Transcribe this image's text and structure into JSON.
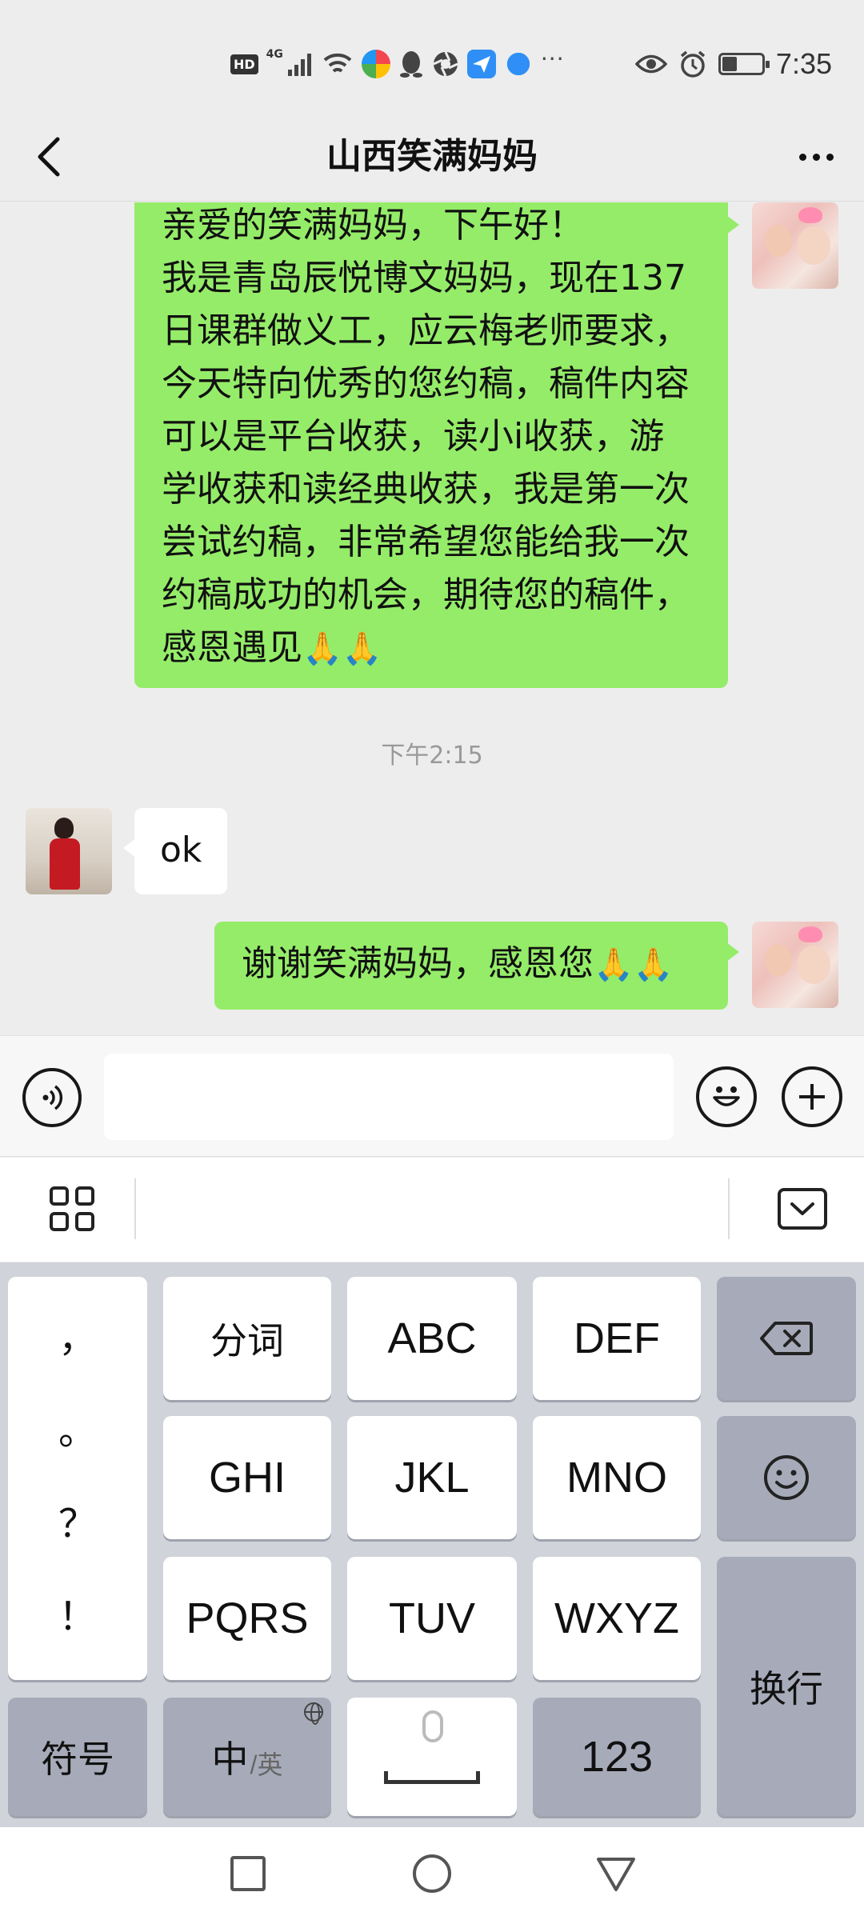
{
  "status_bar": {
    "network_badge": "HD",
    "network_type": "4G",
    "more_indicator": "···",
    "time": "7:35",
    "battery_level": 0.35,
    "app_colors": [
      "#f4464f",
      "#4aa9e8",
      "#20a8ec",
      "#2f8ff6"
    ]
  },
  "nav": {
    "back_icon": "chevron-left-icon",
    "title": "山西笑满妈妈",
    "more_icon": "more-horizontal-icon"
  },
  "chat": {
    "messages": [
      {
        "sender": "me",
        "text": "亲爱的笑满妈妈，下午好！\n我是青岛辰悦博文妈妈，现在137\n日课群做义工，应云梅老师要求，\n今天特向优秀的您约稿，稿件内容\n可以是平台收获，读小i收获，游\n学收获和读经典收获，我是第一次\n尝试约稿，非常希望您能给我一次\n约稿成功的机会，期待您的稿件，\n感恩遇见",
        "emoji": "🙏🙏"
      },
      {
        "type": "timestamp",
        "text": "下午2:15"
      },
      {
        "sender": "other",
        "text": "ok"
      },
      {
        "sender": "me",
        "text": "谢谢笑满妈妈，感恩您",
        "emoji": "🙏🙏"
      }
    ]
  },
  "input_bar": {
    "voice_icon": "voice-icon",
    "input_value": "",
    "emoji_icon": "smiley-icon",
    "plus_icon": "plus-icon"
  },
  "ime": {
    "menu_icon": "grid-icon",
    "collapse_icon": "keyboard-collapse-icon",
    "punctuation": [
      "，",
      "。",
      "？",
      "！"
    ],
    "keys_row1": [
      "分词",
      "ABC",
      "DEF"
    ],
    "keys_row2": [
      "GHI",
      "JKL",
      "MNO"
    ],
    "keys_row3": [
      "PQRS",
      "TUV",
      "WXYZ"
    ],
    "backspace_icon": "backspace-icon",
    "emoji_key_icon": "smiley-icon",
    "enter_label": "换行",
    "symbols_label": "符号",
    "lang_label_main": "中",
    "lang_label_alt": "/英",
    "numbers_label": "123"
  },
  "system_nav": {
    "recent_icon": "square-icon",
    "home_icon": "circle-icon",
    "back_icon": "triangle-back-icon"
  }
}
